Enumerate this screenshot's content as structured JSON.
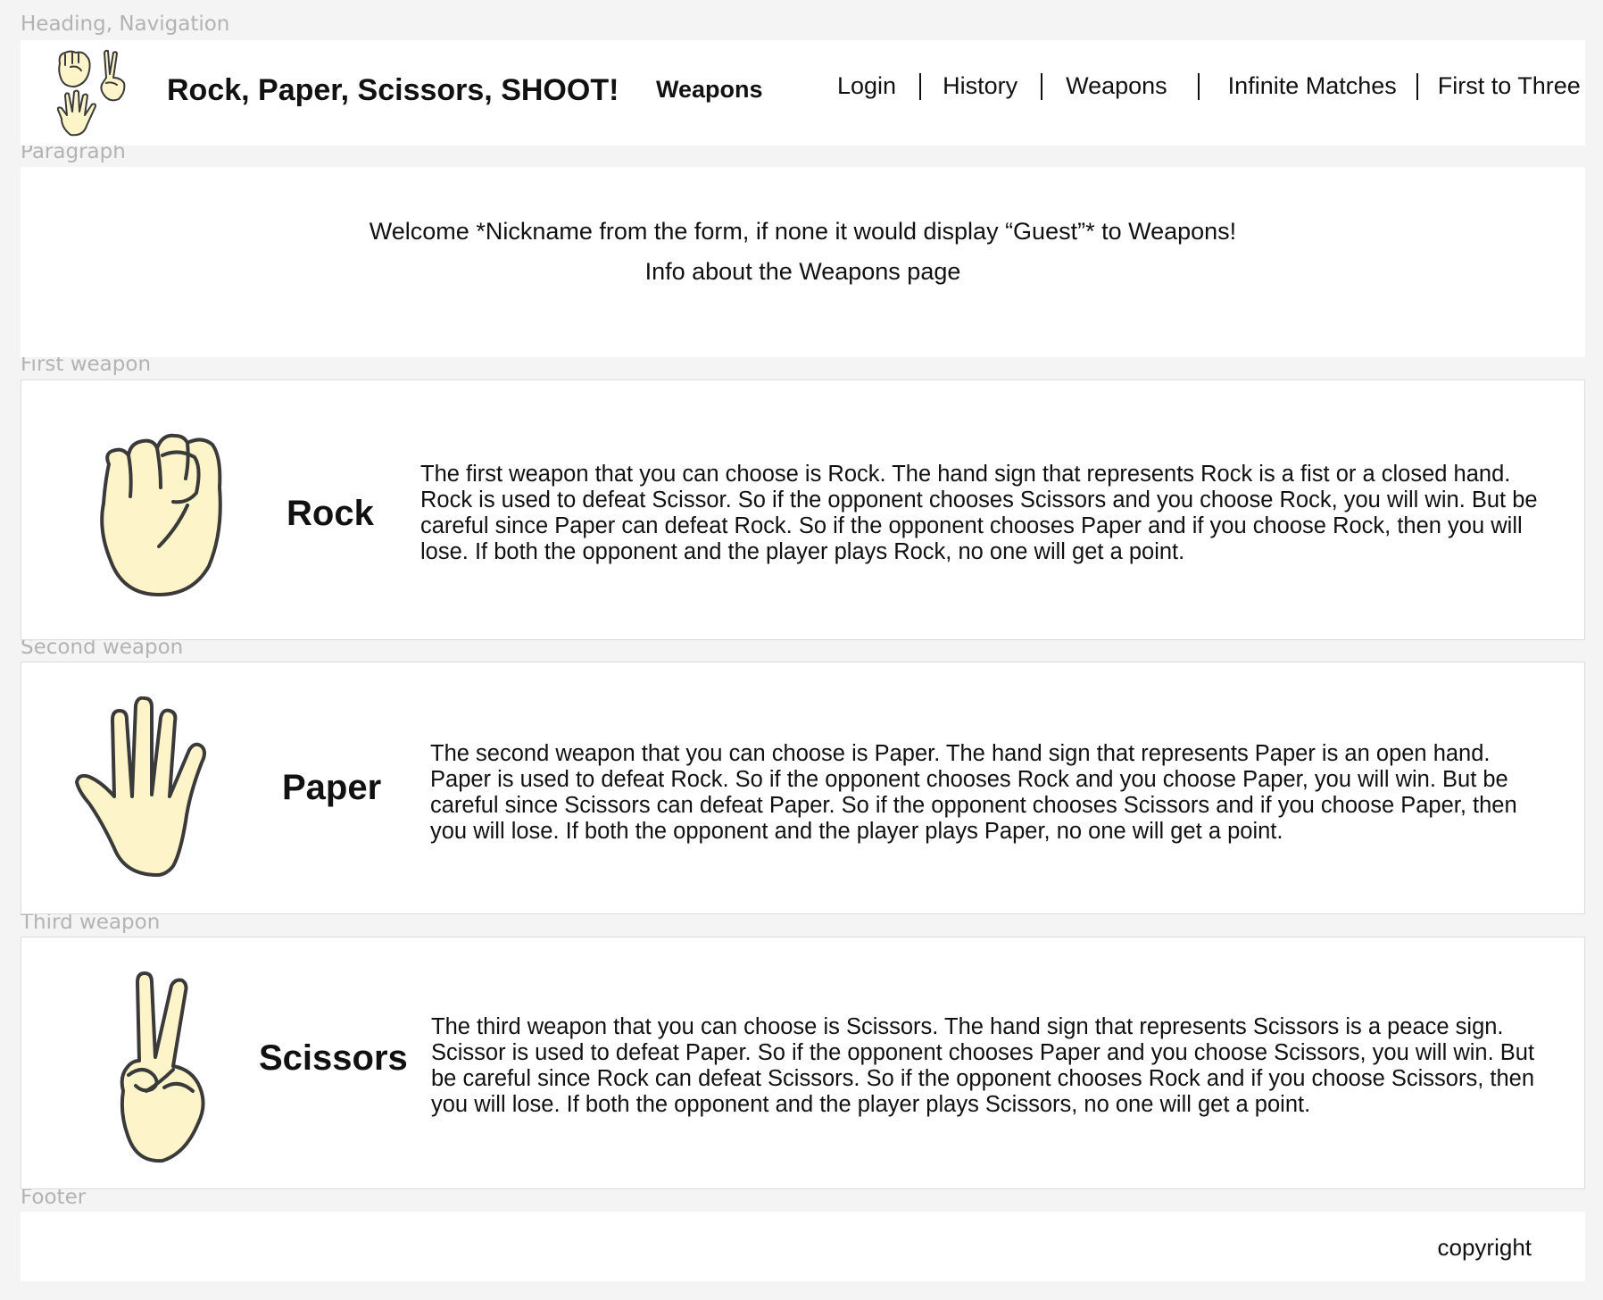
{
  "section_labels": {
    "header": "Heading, Navigation",
    "paragraph": "Paragraph",
    "first_weapon": "First weapon",
    "second_weapon": "Second weapon",
    "third_weapon": "Third weapon",
    "footer": "Footer"
  },
  "header": {
    "title": "Rock, Paper, Scissors, SHOOT!",
    "current_page": "Weapons",
    "nav": [
      {
        "label": "Login"
      },
      {
        "label": "History"
      },
      {
        "label": "Weapons"
      },
      {
        "label": "Infinite Matches"
      },
      {
        "label": "First to Three"
      }
    ]
  },
  "intro": {
    "welcome": "Welcome *Nickname from the form, if none it would display “Guest”* to Weapons!",
    "info": "Info about the Weapons page"
  },
  "weapons": [
    {
      "name": "Rock",
      "icon": "fist-icon",
      "description": "The first weapon that you can choose is Rock. The hand sign that represents Rock is a fist or a closed hand. Rock is used to defeat Scissor. So if the opponent chooses Scissors and you choose Rock, you will win. But be careful since Paper can defeat Rock. So if the opponent chooses Paper and if you choose Rock, then you will lose. If both the opponent and the player plays Rock, no one will get a point."
    },
    {
      "name": "Paper",
      "icon": "open-hand-icon",
      "description": "The second weapon that you can choose is Paper. The hand sign that represents Paper is an open hand. Paper is used to defeat Rock. So if the opponent chooses Rock and you choose Paper, you will win. But be careful since Scissors can defeat Paper. So if the opponent chooses Scissors and if you choose Paper, then you will lose. If both the opponent and the player plays Paper, no one will get a point."
    },
    {
      "name": "Scissors",
      "icon": "peace-sign-icon",
      "description": "The third weapon that you can choose is Scissors. The hand sign that represents Scissors is a peace sign. Scissor is used to defeat Paper. So if the opponent chooses Paper and you choose Scissors, you will win. But be careful since Rock can defeat Scissors. So if the opponent chooses Rock and if you choose Scissors, then you will lose. If both the opponent and the player plays Scissors, no one will get a point."
    }
  ],
  "footer": {
    "copyright": "copyright"
  },
  "colors": {
    "page_bg": "#f4f4f4",
    "card_bg": "#ffffff",
    "label_gray": "#b3b3b3",
    "hand_fill": "#fdf5c9",
    "hand_stroke": "#3a3a3a"
  }
}
